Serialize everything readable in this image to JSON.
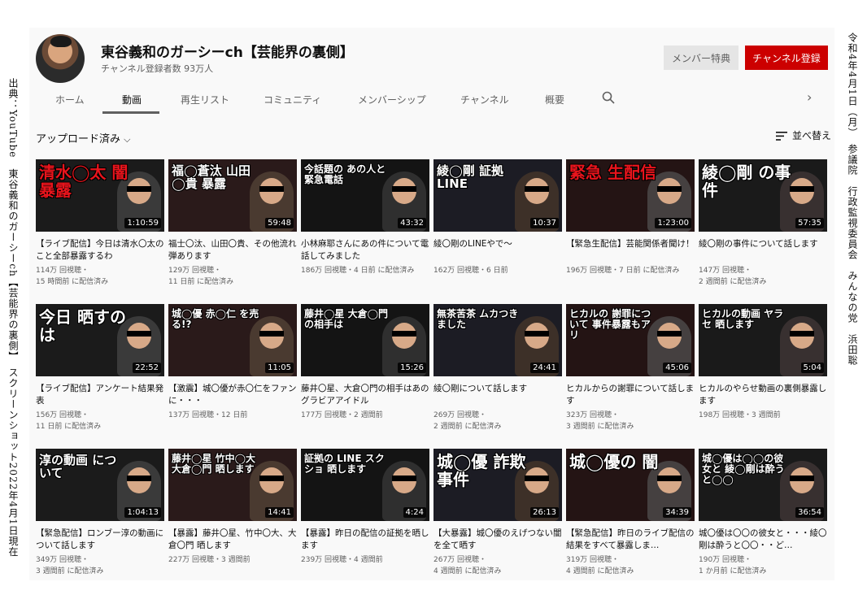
{
  "captions": {
    "left": "出典：YouTube　東谷義和のガーシーch【芸能界の裏側】　スクリーンショット2022年4月1日現在",
    "right": "令和4年4月1日（月）　参議院　行政監視委員会　みんなの党　浜田聡"
  },
  "channel": {
    "title": "東谷義和のガーシーch【芸能界の裏側】",
    "subscribers": "チャンネル登録者数 93万人",
    "membership_button": "メンバー特典",
    "subscribe_button": "チャンネル登録"
  },
  "tabs": [
    "ホーム",
    "動画",
    "再生リスト",
    "コミュニティ",
    "メンバーシップ",
    "チャンネル",
    "概要"
  ],
  "active_tab": "動画",
  "filter": {
    "label": "アップロード済み",
    "sort_label": "並べ替え"
  },
  "videos": [
    {
      "thumb": "清水◯太 闇暴露",
      "thumb_color": "#e8141c",
      "duration": "1:10:59",
      "title": "【ライブ配信】今日は清水〇太のこと全部暴露するわ",
      "views": "114万 回視聴・",
      "age": "15 時間前 に配信済み"
    },
    {
      "thumb": "福◯蒼汰 山田◯貴 暴露",
      "thumb_color": "#ffffff",
      "duration": "59:48",
      "title": "福士〇汰、山田〇貴、その他流れ弾あります",
      "views": "129万 回視聴・",
      "age": "11 日前 に配信済み"
    },
    {
      "thumb": "今話題の あの人と 緊急電話",
      "thumb_color": "#ffffff",
      "duration": "43:32",
      "title": "小林麻耶さんにあの件について電話してみました",
      "views": "186万 回視聴・4 日前 に配信済み",
      "age": ""
    },
    {
      "thumb": "綾◯剛 証拠LINE",
      "thumb_color": "#ffffff",
      "duration": "10:37",
      "title": "綾〇剛のLINEやで〜",
      "views": "162万 回視聴・6 日前",
      "age": ""
    },
    {
      "thumb": "緊急 生配信",
      "thumb_color": "#e8141c",
      "duration": "1:23:00",
      "title": "【緊急生配信】芸能関係者聞け！",
      "views": "196万 回視聴・7 日前 に配信済み",
      "age": ""
    },
    {
      "thumb": "綾◯剛 の事件",
      "thumb_color": "#ffffff",
      "duration": "57:35",
      "title": "綾〇剛の事件について話します",
      "views": "147万 回視聴・",
      "age": "2 週間前 に配信済み"
    },
    {
      "thumb": "今日 晒すのは",
      "thumb_color": "#ffffff",
      "duration": "22:52",
      "title": "【ライブ配信】アンケート結果発表",
      "views": "156万 回視聴・",
      "age": "11 日前 に配信済み"
    },
    {
      "thumb": "城◯優 赤◯仁 を売る!?",
      "thumb_color": "#ffffff",
      "duration": "11:05",
      "title": "【激震】城〇優が赤〇仁をファンに・・・",
      "views": "137万 回視聴・12 日前",
      "age": ""
    },
    {
      "thumb": "藤井◯星 大倉◯門 の相手は",
      "thumb_color": "#ffffff",
      "duration": "15:26",
      "title": "藤井〇星、大倉〇門の相手はあのグラビアアイドル",
      "views": "177万 回視聴・2 週間前",
      "age": ""
    },
    {
      "thumb": "無茶苦茶 ムカつき ました",
      "thumb_color": "#ffffff",
      "duration": "24:41",
      "title": "綾〇剛について話します",
      "views": "269万 回視聴・",
      "age": "2 週間前 に配信済み"
    },
    {
      "thumb": "ヒカルの 謝罪について 事件暴露もアリ",
      "thumb_color": "#ffffff",
      "duration": "45:06",
      "title": "ヒカルからの謝罪について話します",
      "views": "323万 回視聴・",
      "age": "3 週間前 に配信済み"
    },
    {
      "thumb": "ヒカルの動画 ヤラセ 晒します",
      "thumb_color": "#ffffff",
      "duration": "5:04",
      "title": "ヒカルのやらせ動画の裏側暴露します",
      "views": "198万 回視聴・3 週間前",
      "age": ""
    },
    {
      "thumb": "淳の動画 について",
      "thumb_color": "#ffffff",
      "duration": "1:04:13",
      "title": "【緊急配信】ロンブー淳の動画について話します",
      "views": "349万 回視聴・",
      "age": "3 週間前 に配信済み"
    },
    {
      "thumb": "藤井◯星 竹中◯大 大倉◯門 晒します",
      "thumb_color": "#ffffff",
      "duration": "14:41",
      "title": "【暴露】藤井〇星、竹中〇大、大倉〇門 晒します",
      "views": "227万 回視聴・3 週間前",
      "age": ""
    },
    {
      "thumb": "証拠の LINE スクショ 晒します",
      "thumb_color": "#ffffff",
      "duration": "4:24",
      "title": "【暴露】昨日の配信の証拠を晒します",
      "views": "239万 回視聴・4 週間前",
      "age": ""
    },
    {
      "thumb": "城◯優 詐欺事件",
      "thumb_color": "#ffffff",
      "duration": "26:13",
      "title": "【大暴露】城〇優のえげつない闇を全て晒す",
      "views": "267万 回視聴・",
      "age": "4 週間前 に配信済み"
    },
    {
      "thumb": "城◯優の 闇",
      "thumb_color": "#ffffff",
      "duration": "34:39",
      "title": "【緊急配信】昨日のライブ配信の結果をすべて暴露しま…",
      "views": "319万 回視聴・",
      "age": "4 週間前 に配信済み"
    },
    {
      "thumb": "城◯優は◯◯の彼女と 綾◯剛は酔うと◯◯",
      "thumb_color": "#ffffff",
      "duration": "36:54",
      "title": "城〇優は〇〇の彼女と・・・綾〇剛は酔うと〇〇・・ど…",
      "views": "190万 回視聴・",
      "age": "1 か月前 に配信済み"
    }
  ],
  "colors": {
    "accent_red": "#cc0000",
    "text_primary": "#0f0f0f",
    "text_secondary": "#606060"
  }
}
